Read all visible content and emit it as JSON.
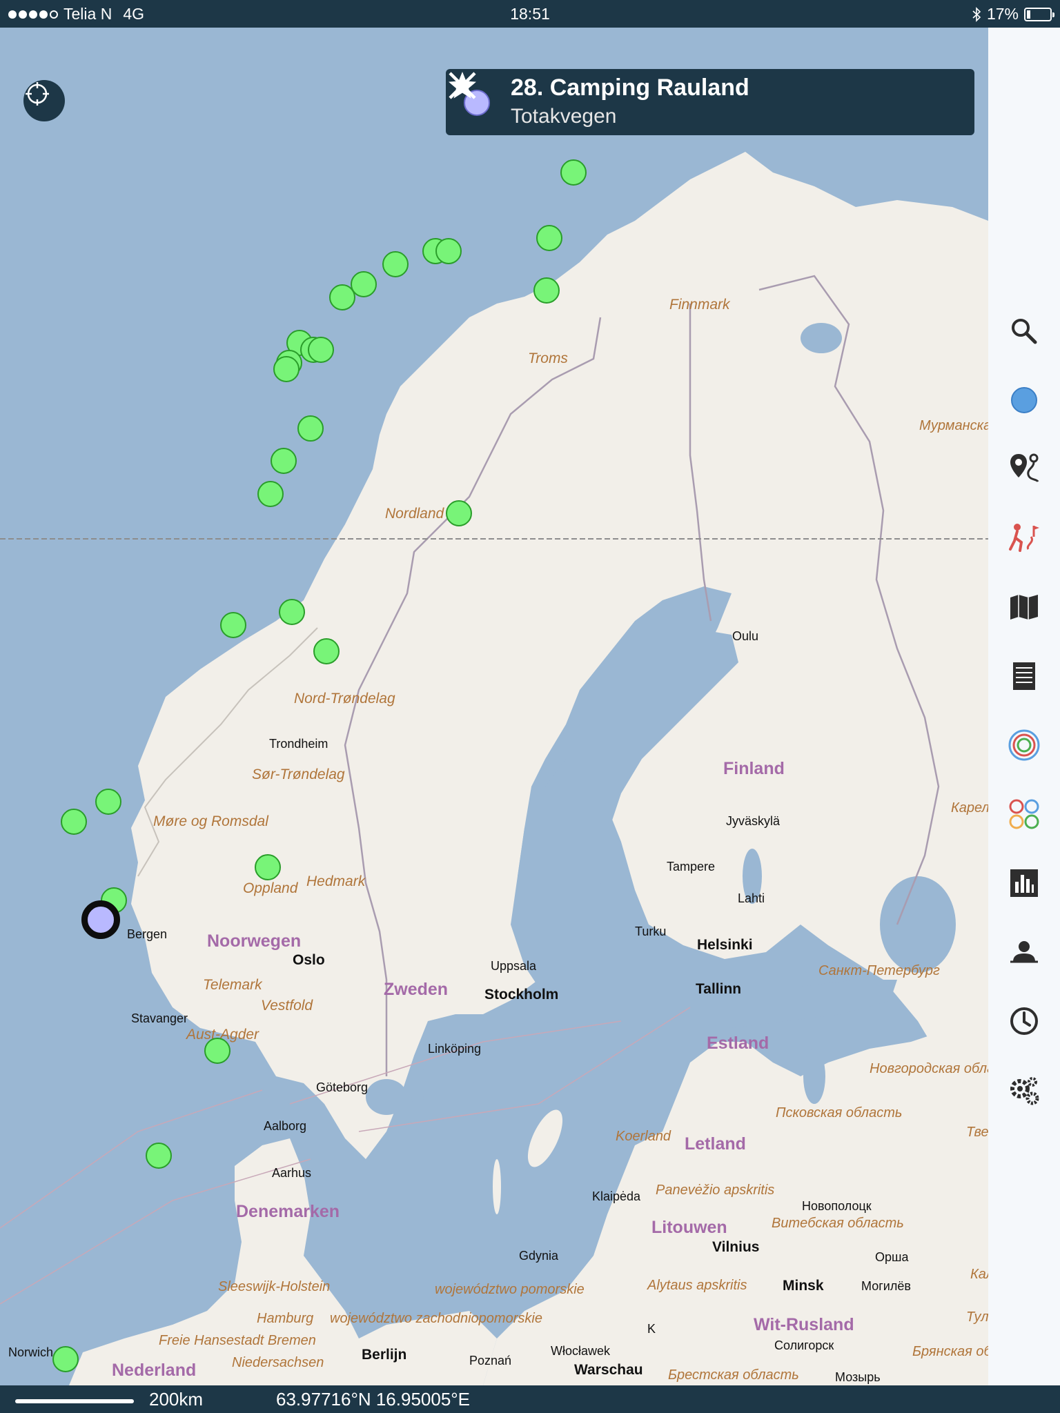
{
  "status_bar": {
    "carrier": "Telia N",
    "network": "4G",
    "time": "18:51",
    "battery": "17%",
    "signal_dots_filled": 4,
    "signal_dots_total": 5
  },
  "info_card": {
    "title": "28. Camping Rauland",
    "subtitle": "Totakvegen",
    "favorite_icon": "star-icon",
    "close_icon": "close-icon"
  },
  "map": {
    "region_labels": [
      "Finnmark",
      "Troms",
      "Nordland",
      "Nord-Trøndelag",
      "Sør-Trøndelag",
      "Møre og Romsdal",
      "Oppland",
      "Hedmark",
      "Vestfold",
      "Aust-Agder",
      "Telemark"
    ],
    "country_labels": [
      "Noorwegen",
      "Zweden",
      "Finland",
      "Estland",
      "Letland",
      "Litouwen",
      "Denemarken",
      "Wit-Rusland",
      "Nederland"
    ],
    "city_labels": [
      "Trondheim",
      "Bergen",
      "Stavanger",
      "Uppsala",
      "Göteborg",
      "Linköping",
      "Aalborg",
      "Aarhus",
      "Jyväskylä",
      "Tampere",
      "Lahti",
      "Turku",
      "Oulu",
      "Gdynia",
      "Klaipėda",
      "Новополоцк",
      "Орша",
      "Могилёв",
      "Солигорск",
      "Мозырь",
      "Poznań",
      "Włocławek",
      "Norwich",
      "K"
    ],
    "capital_labels": [
      "Oslo",
      "Stockholm",
      "Helsinki",
      "Tallinn",
      "Vilnius",
      "Minsk",
      "Berlijn",
      "Warschau"
    ],
    "foreign_region_labels": [
      "Мурманская облас",
      "Карелия",
      "Санкт-Петербург",
      "Новгородская область",
      "Псковская область",
      "Тверская обл",
      "Koerland",
      "Panevėžio apskritis",
      "Витебская область",
      "Alytaus apskritis",
      "Калужская",
      "Тула",
      "Брянская область",
      "Брестская область",
      "Sleeswijk-Holstein",
      "województwo pomorskie",
      "Hamburg",
      "województwo zachodniopomorskie",
      "Freie Hansestadt Bremen",
      "Niedersachsen"
    ],
    "markers": [
      {
        "lat": 71.1,
        "lon": 25.8
      },
      {
        "lat": 70.1,
        "lon": 24.9
      },
      {
        "lat": 69.9,
        "lon": 20.6
      },
      {
        "lat": 69.9,
        "lon": 21.1
      },
      {
        "lat": 69.7,
        "lon": 19.1
      },
      {
        "lat": 69.4,
        "lon": 17.9
      },
      {
        "lat": 69.2,
        "lon": 17.1
      },
      {
        "lat": 69.3,
        "lon": 24.8
      },
      {
        "lat": 68.5,
        "lon": 15.5
      },
      {
        "lat": 68.4,
        "lon": 16.0
      },
      {
        "lat": 68.4,
        "lon": 16.3
      },
      {
        "lat": 68.2,
        "lon": 15.1
      },
      {
        "lat": 68.1,
        "lon": 15.0
      },
      {
        "lat": 67.2,
        "lon": 15.9
      },
      {
        "lat": 66.7,
        "lon": 14.9
      },
      {
        "lat": 66.2,
        "lon": 14.4
      },
      {
        "lat": 65.9,
        "lon": 21.5
      },
      {
        "lat": 64.4,
        "lon": 15.2
      },
      {
        "lat": 64.2,
        "lon": 13.0
      },
      {
        "lat": 63.8,
        "lon": 16.5
      },
      {
        "lat": 61.5,
        "lon": 8.3
      },
      {
        "lat": 61.2,
        "lon": 7.0
      },
      {
        "lat": 60.5,
        "lon": 14.3
      },
      {
        "lat": 60.0,
        "lon": 8.5
      },
      {
        "lat": 57.7,
        "lon": 12.4
      },
      {
        "lat": 56.1,
        "lon": 10.2
      },
      {
        "lat": 53.0,
        "lon": 6.7
      }
    ],
    "selected_marker": {
      "name": "28. Camping Rauland",
      "lat": 59.7,
      "lon": 8.0
    }
  },
  "toolbar": {
    "items": [
      "search-icon",
      "location-dot-icon",
      "route-pin-icon",
      "hiking-icon",
      "map-icon",
      "list-icon",
      "layers-rings-icon",
      "categories-icon",
      "chart-icon",
      "contacts-icon",
      "history-icon",
      "settings-icon"
    ]
  },
  "bottom_bar": {
    "scale": "200km",
    "coordinates": "63.97716°N 16.95005°E"
  },
  "colors": {
    "header_bg": "#1d3747",
    "water": "#9ab7d3",
    "land": "#f2efe9",
    "marker_fill": "#78f478",
    "selected_fill": "#b9b9ff",
    "toolbar_accent": "#d9534f"
  }
}
